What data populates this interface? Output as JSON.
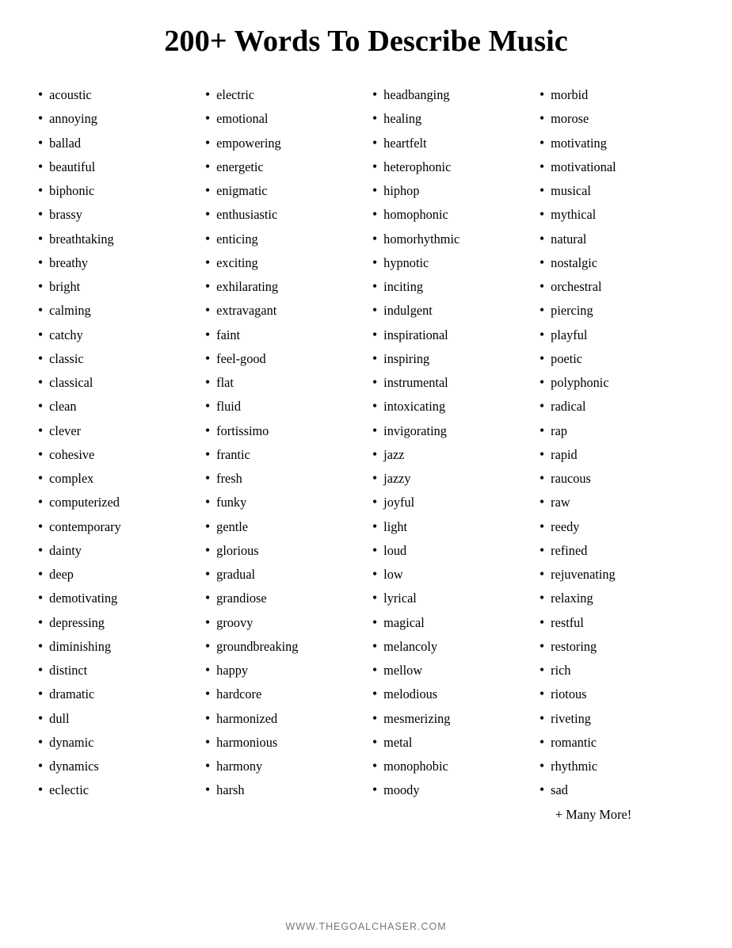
{
  "title": "200+ Words To Describe Music",
  "columns": [
    {
      "id": "col1",
      "items": [
        "acoustic",
        "annoying",
        "ballad",
        "beautiful",
        "biphonic",
        "brassy",
        "breathtaking",
        "breathy",
        "bright",
        "calming",
        "catchy",
        "classic",
        "classical",
        "clean",
        "clever",
        "cohesive",
        "complex",
        "computerized",
        "contemporary",
        "dainty",
        "deep",
        "demotivating",
        "depressing",
        "diminishing",
        "distinct",
        "dramatic",
        "dull",
        "dynamic",
        "dynamics",
        "eclectic"
      ]
    },
    {
      "id": "col2",
      "items": [
        "electric",
        "emotional",
        "empowering",
        "energetic",
        "enigmatic",
        "enthusiastic",
        "enticing",
        "exciting",
        "exhilarating",
        "extravagant",
        "faint",
        "feel-good",
        "flat",
        "fluid",
        "fortissimo",
        "frantic",
        "fresh",
        "funky",
        "gentle",
        "glorious",
        "gradual",
        "grandiose",
        "groovy",
        "groundbreaking",
        "happy",
        "hardcore",
        "harmonized",
        "harmonious",
        "harmony",
        "harsh"
      ]
    },
    {
      "id": "col3",
      "items": [
        "headbanging",
        "healing",
        "heartfelt",
        "heterophonic",
        "hiphop",
        "homophonic",
        "homorhythmic",
        "hypnotic",
        "inciting",
        "indulgent",
        "inspirational",
        "inspiring",
        "instrumental",
        "intoxicating",
        "invigorating",
        "jazz",
        "jazzy",
        "joyful",
        "light",
        "loud",
        "low",
        "lyrical",
        "magical",
        "melancoly",
        "mellow",
        "melodious",
        "mesmerizing",
        "metal",
        "monophobic",
        "moody"
      ]
    },
    {
      "id": "col4",
      "items": [
        "morbid",
        "morose",
        "motivating",
        "motivational",
        "musical",
        "mythical",
        "natural",
        "nostalgic",
        "orchestral",
        "piercing",
        "playful",
        "poetic",
        "polyphonic",
        "radical",
        "rap",
        "rapid",
        "raucous",
        "raw",
        "reedy",
        "refined",
        "rejuvenating",
        "relaxing",
        "restful",
        "restoring",
        "rich",
        "riotous",
        "riveting",
        "romantic",
        "rhythmic",
        "sad"
      ]
    }
  ],
  "more": "+ Many More!",
  "footer": "WWW.THEGOALCHASER.COM"
}
